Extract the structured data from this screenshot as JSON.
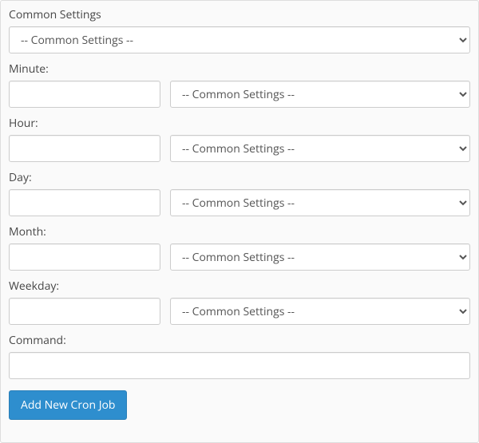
{
  "common_settings": {
    "label": "Common Settings",
    "placeholder": "-- Common Settings --"
  },
  "fields": {
    "minute": {
      "label": "Minute:",
      "value": "",
      "select_placeholder": "-- Common Settings --"
    },
    "hour": {
      "label": "Hour:",
      "value": "",
      "select_placeholder": "-- Common Settings --"
    },
    "day": {
      "label": "Day:",
      "value": "",
      "select_placeholder": "-- Common Settings --"
    },
    "month": {
      "label": "Month:",
      "value": "",
      "select_placeholder": "-- Common Settings --"
    },
    "weekday": {
      "label": "Weekday:",
      "value": "",
      "select_placeholder": "-- Common Settings --"
    }
  },
  "command": {
    "label": "Command:",
    "value": ""
  },
  "submit": {
    "label": "Add New Cron Job"
  }
}
